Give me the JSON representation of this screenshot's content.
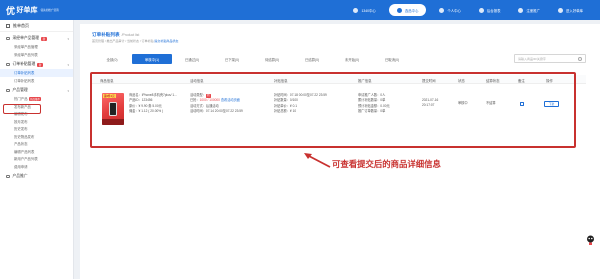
{
  "header": {
    "logo_mark": "优",
    "logo_text": "好单库",
    "logo_sub": "领先的推广营销",
    "nav": [
      {
        "label": "1340中心"
      },
      {
        "label": "选品中心"
      },
      {
        "label": "个人中心"
      },
      {
        "label": "后台报表"
      },
      {
        "label": "注册推广"
      },
      {
        "label": "进入好单库"
      }
    ]
  },
  "sidebar": {
    "home": "推单首页",
    "group1": {
      "title": "采经单产品管理",
      "badge": "新",
      "items": [
        "采经单产品管理",
        "采经单产品列表"
      ]
    },
    "group2": {
      "title": "订单补贴管理",
      "badge": "新",
      "items": [
        "订单补贴列表",
        "订单补贴列表"
      ]
    },
    "group3": {
      "title": "产品管理",
      "items": [
        {
          "label": "热门产品",
          "badge": "新品推荐"
        },
        {
          "label": "发布新产品"
        },
        {
          "label": "编辑发布"
        },
        {
          "label": "按月发布"
        },
        {
          "label": "历史发布"
        },
        {
          "label": "历史物品发布"
        },
        {
          "label": "产品状态"
        },
        {
          "label": "编辑产品列表"
        },
        {
          "label": "新用户产品列表"
        },
        {
          "label": "费用申请"
        }
      ]
    },
    "bottom": "产品推广"
  },
  "main": {
    "title": "订单补贴列表",
    "title_en": "/Product list",
    "breadcrumb_prefix": "首页管理 / 推出产品审计 / 当前状态 / 订单补贴",
    "breadcrumb_link": "提交补贴商品状态",
    "tabs": [
      {
        "label": "全部(0)"
      },
      {
        "label": "审核中(1)"
      },
      {
        "label": "已通过(0)"
      },
      {
        "label": "已下架(0)"
      },
      {
        "label": "待结算(0)"
      },
      {
        "label": "已结算(0)"
      },
      {
        "label": "未开始(0)"
      },
      {
        "label": "已取消(0)"
      }
    ],
    "search_placeholder": "请输入商品ID/关键字",
    "columns": [
      "商品信息",
      "活动信息",
      "补贴信息",
      "推广信息",
      "提交时间",
      "状态",
      "结算状态",
      "备注",
      "操作"
    ],
    "row": {
      "img_tag": "第2件1元",
      "product_name": "商品名：iPhone8手机壳7plus/ 1...",
      "product_id": "产品ID：123456",
      "price": "原价：¥ 9.90  券 5.00元",
      "commission": "佣金：¥ 1.12 ( 20.00% )",
      "activity_type_label": "活动类型：",
      "activity_type_tag": "新",
      "activity_stock_label": "已抢：",
      "activity_stock_value": "1000 / 100000",
      "activity_stock_link": "查看活动页面",
      "activity_mode": "活动方式：后通活动",
      "activity_time": "活动时间：07.14 20:00至07.22 23:59",
      "subsidy_time": "补贴时间：07.18 00:00至07.22 23:59",
      "subsidy_count": "补贴数量：0/100",
      "subsidy_price": "补贴单价：¥ 0.1",
      "subsidy_total": "补贴总额：¥ 10",
      "promo_1": "申请推广人数：0人",
      "promo_2": "累计补贴数量：0单",
      "promo_3": "预计补贴金额：0.00元",
      "promo_4": "推广订单数量：0单",
      "submit_date": "2021-07-16",
      "submit_time": "20:17:07",
      "status": "审核中",
      "settle_status": "不结算",
      "op_label": "下架"
    }
  },
  "annotation": "可查看提交后的商品详细信息"
}
